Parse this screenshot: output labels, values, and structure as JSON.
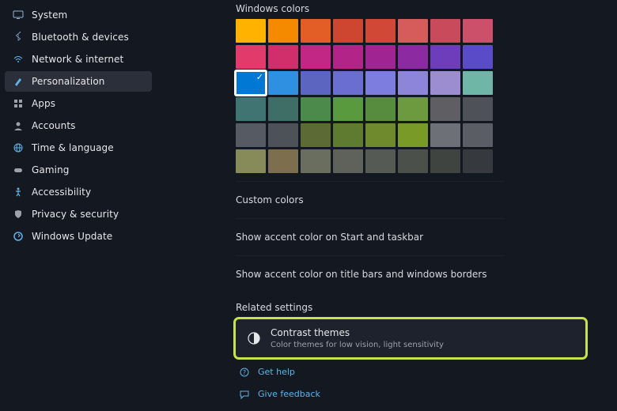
{
  "sidebar": {
    "items": [
      {
        "label": "System"
      },
      {
        "label": "Bluetooth & devices"
      },
      {
        "label": "Network & internet"
      },
      {
        "label": "Personalization"
      },
      {
        "label": "Apps"
      },
      {
        "label": "Accounts"
      },
      {
        "label": "Time & language"
      },
      {
        "label": "Gaming"
      },
      {
        "label": "Accessibility"
      },
      {
        "label": "Privacy & security"
      },
      {
        "label": "Windows Update"
      }
    ],
    "selected_index": 3
  },
  "colors_section": {
    "heading": "Windows colors",
    "swatches": [
      "#ffb300",
      "#f58a00",
      "#e35d27",
      "#cf4630",
      "#d24836",
      "#d65c5b",
      "#c94a5a",
      "#cc506a",
      "#e23a6b",
      "#d12f6c",
      "#c32785",
      "#b32489",
      "#a02593",
      "#8c2aa1",
      "#6e3dbb",
      "#5a4bc9",
      "#0078d4",
      "#2f8fe0",
      "#5c65c0",
      "#6b6ed1",
      "#7d7de0",
      "#8d85d9",
      "#9c8dd0",
      "#6fb6a6",
      "#3f7472",
      "#3f6e66",
      "#4b8a4a",
      "#5a9a3e",
      "#578b3e",
      "#6d9a3f",
      "#5e5e63",
      "#4e5258",
      "#565a63",
      "#4d5158",
      "#5c6b36",
      "#5f7b30",
      "#6f8a2c",
      "#7a9a28",
      "#6e7077",
      "#5a5d64",
      "#878b5a",
      "#7d6f4d",
      "#6a6e5e",
      "#5e625a",
      "#555a54",
      "#4b504b",
      "#404440",
      "#36393e"
    ],
    "selected_swatch_index": 16
  },
  "options": {
    "custom_colors": "Custom colors",
    "accent_start": "Show accent color on Start and taskbar",
    "accent_title": "Show accent color on title bars and windows borders"
  },
  "related": {
    "heading": "Related settings",
    "contrast": {
      "title": "Contrast themes",
      "subtitle": "Color themes for low vision, light sensitivity"
    }
  },
  "links": {
    "help": "Get help",
    "feedback": "Give feedback"
  },
  "accent_color": "#0078d4"
}
